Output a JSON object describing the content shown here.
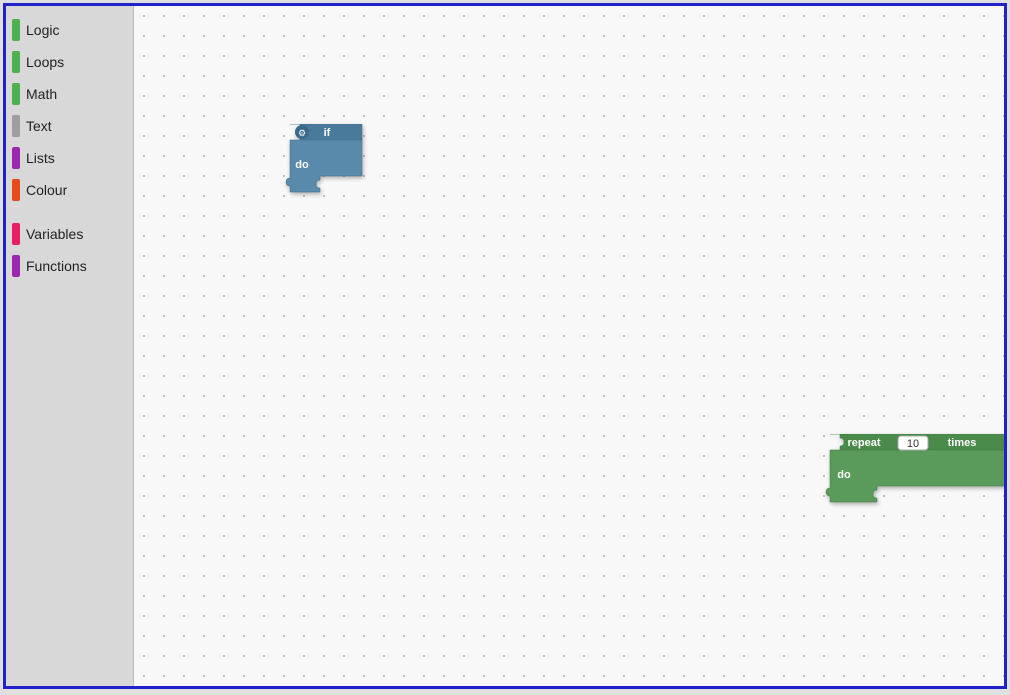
{
  "sidebar": {
    "items": [
      {
        "label": "Logic",
        "color": "#4CAF50",
        "id": "logic"
      },
      {
        "label": "Loops",
        "color": "#4CAF50",
        "id": "loops"
      },
      {
        "label": "Math",
        "color": "#4CAF50",
        "id": "math"
      },
      {
        "label": "Text",
        "color": "#9E9E9E",
        "id": "text"
      },
      {
        "label": "Lists",
        "color": "#9C27B0",
        "id": "lists"
      },
      {
        "label": "Colour",
        "color": "#E64A19",
        "id": "colour"
      },
      {
        "label": "Variables",
        "color": "#E91E63",
        "id": "variables"
      },
      {
        "label": "Functions",
        "color": "#9C27B0",
        "id": "functions"
      }
    ],
    "spacer_after_index": 5
  },
  "blocks": {
    "if_block": {
      "gear_symbol": "⚙",
      "if_label": "if",
      "do_label": "do"
    },
    "repeat_block": {
      "repeat_label": "repeat",
      "value": "10",
      "times_label": "times",
      "do_label": "do"
    }
  }
}
